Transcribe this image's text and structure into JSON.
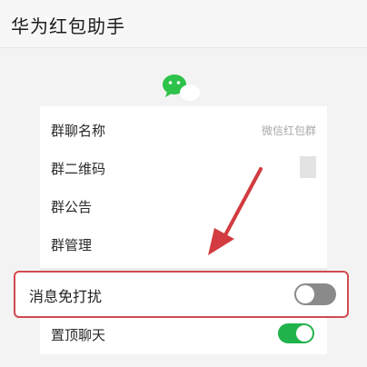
{
  "header": {
    "title": "华为红包助手"
  },
  "group_settings": {
    "items": [
      {
        "label": "群聊名称",
        "value": "微信红包群"
      },
      {
        "label": "群二维码"
      },
      {
        "label": "群公告"
      },
      {
        "label": "群管理"
      }
    ]
  },
  "do_not_disturb": {
    "label": "消息免打扰",
    "enabled": false
  },
  "pin_chat": {
    "label": "置顶聊天",
    "enabled": true
  },
  "colors": {
    "highlight_border": "#d24a4f",
    "arrow": "#d23b3f",
    "toggle_on": "#21b34b",
    "toggle_off": "#8a8a8a",
    "wechat_green": "#2dc24a"
  },
  "icons": {
    "avatar": "wechat-logo-icon",
    "annotation": "red-arrow-icon"
  }
}
